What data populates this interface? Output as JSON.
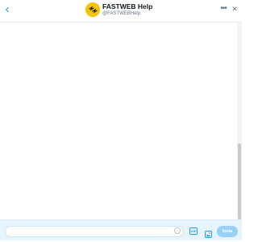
{
  "header": {
    "back_icon": "chevron-left-icon",
    "display_name": "FASTWEB Help",
    "handle": "@FASTWEBHelp",
    "avatar_color": "#f5c400",
    "more_icon": "more-horizontal-icon",
    "close_icon": "close-icon"
  },
  "composer": {
    "input_placeholder": "",
    "emoji_icon": "emoji-icon",
    "gif_icon": "gif-icon",
    "media_icon": "image-icon",
    "send_label": "Invia"
  },
  "colors": {
    "accent": "#1da1f2",
    "composer_background": "#e8f5fd"
  }
}
